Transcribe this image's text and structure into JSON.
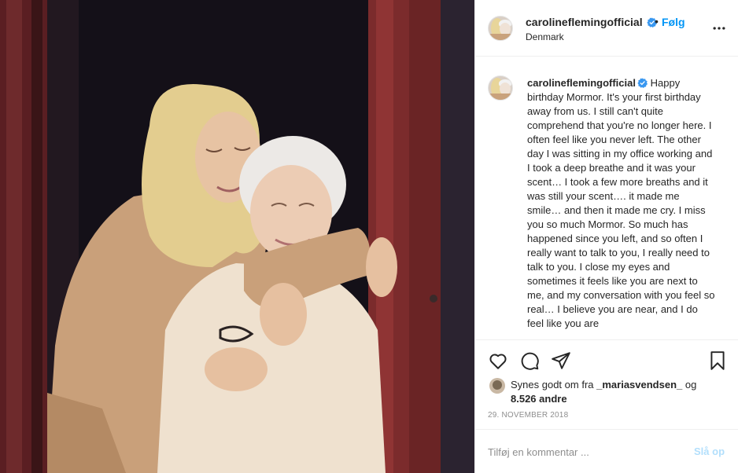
{
  "photo": {
    "alt_icon": "photo-two-women-hugging"
  },
  "header": {
    "username": "carolineflemingofficial",
    "separator": "•",
    "follow_label": "Følg",
    "location": "Denmark",
    "more_icon": "more-horizontal-icon"
  },
  "caption": {
    "username": "carolineflemingofficial",
    "text": "Happy birthday Mormor. It's your first birthday away from us. I still can't quite comprehend that you're no longer here. I often feel like you never left. The other day I was sitting in my office working and I took a deep breathe and it was your scent… I took a few more breaths and it was still your scent…. it made me smile… and then it made me cry. I miss you so much Mormor. So much has happened since you left, and so often I really want to talk to you, I really need to talk to you. I close my eyes and sometimes it feels like you are next to me, and my conversation with you feel so real… I believe you are near, and I do feel like you are"
  },
  "actions": {
    "icons": [
      "heart-icon",
      "comment-icon",
      "share-icon",
      "bookmark-icon"
    ]
  },
  "likes": {
    "prefix": "Synes godt om fra ",
    "liker": "_mariasvendsen_",
    "joiner": " og ",
    "count_text": "8.526 andre"
  },
  "date": "29. NOVEMBER 2018",
  "comment": {
    "placeholder": "Tilføj en kommentar ...",
    "post_label": "Slå op"
  },
  "colors": {
    "accent": "#0095f6",
    "post_disabled": "#b2dffc",
    "verified": "#3897f0",
    "door": "#7a2a2a"
  }
}
